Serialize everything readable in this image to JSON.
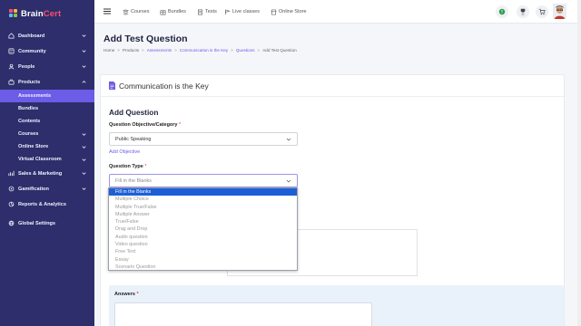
{
  "brand": {
    "name_part1": "Brain",
    "name_part2": "Cert"
  },
  "sidebar": {
    "items": [
      {
        "label": "Dashboard",
        "icon": "dashboard-icon"
      },
      {
        "label": "Community",
        "icon": "community-icon"
      },
      {
        "label": "People",
        "icon": "people-icon"
      },
      {
        "label": "Products",
        "icon": "products-icon"
      }
    ],
    "sub_items": [
      {
        "label": "Assessments",
        "active": true
      },
      {
        "label": "Bundles"
      },
      {
        "label": "Contents"
      },
      {
        "label": "Courses",
        "has_children": true
      },
      {
        "label": "Online Store",
        "has_children": true
      },
      {
        "label": "Virtual Classroom",
        "has_children": true
      }
    ],
    "lower_items": [
      {
        "label": "Sales & Marketing",
        "icon": "sales-icon"
      },
      {
        "label": "Gamification",
        "icon": "gamification-icon"
      },
      {
        "label": "Reports & Analytics",
        "icon": "reports-icon"
      },
      {
        "label": "Global Settings",
        "icon": "settings-icon"
      }
    ]
  },
  "topbar": {
    "links": [
      "Courses",
      "Bundles",
      "Tests",
      "Live classes",
      "Online Store"
    ]
  },
  "page": {
    "title": "Add Test Question",
    "breadcrumb": [
      "Home",
      "Products",
      "Assessments",
      "Communication is the Key",
      "Questions",
      "Add Test Question"
    ]
  },
  "card": {
    "title": "Communication is the Key"
  },
  "form": {
    "section_title": "Add Question",
    "objective_label": "Question Objective/Category",
    "objective_value": "Public Speaking",
    "add_objective_link": "Add Objective",
    "type_label": "Question Type",
    "type_value": "Fill in the Blanks",
    "required_mark": "*",
    "answers_label": "Answers"
  },
  "dropdown": {
    "options": [
      "Fill in the Blanks",
      "Multiple Choice",
      "Multiple True/False",
      "Multiple Answer",
      "True/False",
      "Drag and Drop",
      "Audio question",
      "Video question",
      "Free Text",
      "Essay",
      "Scenario Question"
    ],
    "selected": "Fill in the Blanks"
  },
  "colors": {
    "sidebar_bg": "#2d2e6b",
    "active": "#6c5ce7",
    "selected_option": "#1d5fd6"
  }
}
